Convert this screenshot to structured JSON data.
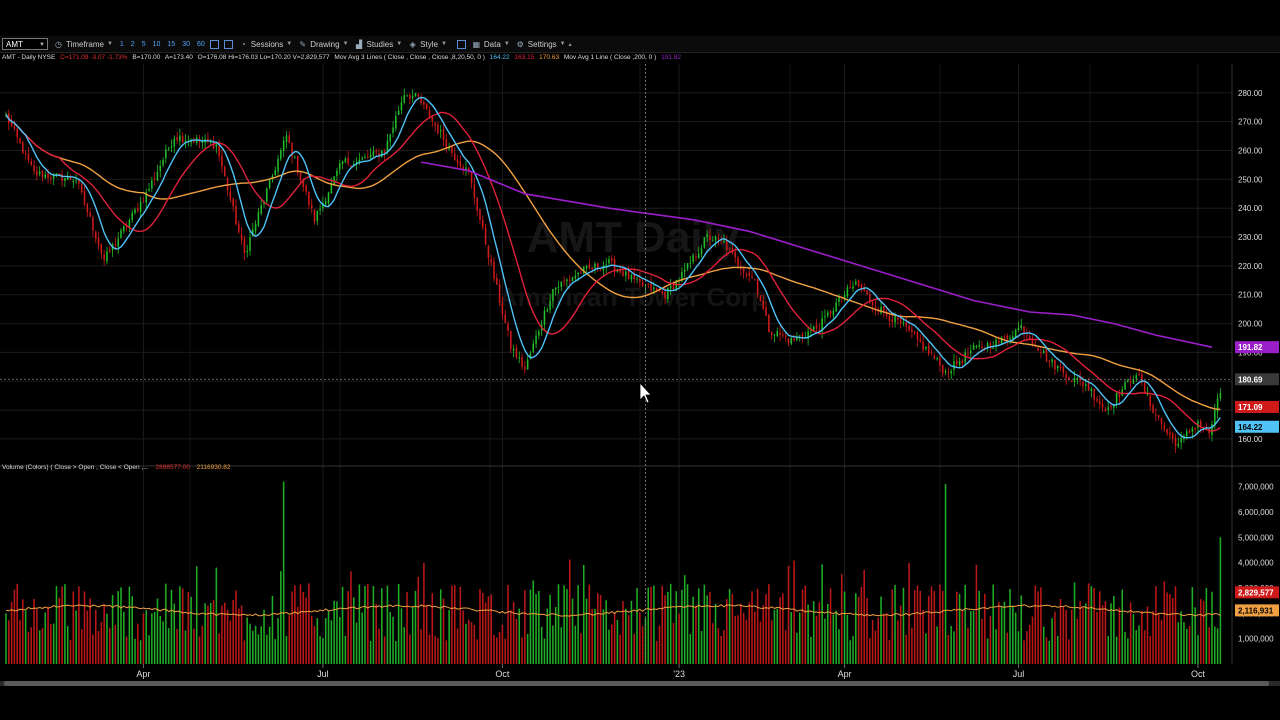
{
  "toolbar": {
    "symbol": "AMT",
    "timeframe_label": "Timeframe",
    "timeframe_buttons": [
      "1",
      "2",
      "5",
      "10",
      "15",
      "30",
      "60"
    ],
    "sessions_label": "Sessions",
    "drawing_label": "Drawing",
    "studies_label": "Studies",
    "style_label": "Style",
    "data_label": "Data",
    "settings_label": "Settings"
  },
  "info": {
    "symbol_line": "AMT - Daily  NYSE",
    "change": "C=171.09  -3.07  -1.73%",
    "bid": "B=170.00",
    "ask": "A=173.40",
    "ohlc": "O=176.08  Hi=176.03  Lo=170.20  V=2,829,577",
    "ma3_label": "Mov Avg 3 Lines ( Close , Close , Close ,8,20,50, 0 )",
    "ma3_v1": "164.22",
    "ma3_v2": "163.15",
    "ma3_v3": "170.63",
    "ma1_label": "Mov Avg 1 Line ( Close ,200, 0 )",
    "ma1_v": "191.82"
  },
  "watermark": {
    "title": "AMT Daily",
    "subtitle": "American Tower Corp"
  },
  "volume": {
    "header": "Volume (Colors) ( Close > Open , Close < Open ,...",
    "v1": "2898577.00",
    "v2": "2116930.82"
  },
  "price_badges": {
    "crosshair": "180.69",
    "ma200": "191.82",
    "last": "171.09",
    "ma8": "164.22"
  },
  "volume_badges": {
    "last": "2,829,577",
    "avg": "2,116,931"
  },
  "colors": {
    "up": "#22c02a",
    "down": "#d01a1a",
    "ma_fast": "#4fc3f7",
    "ma_mid": "#e0213a",
    "ma_slow": "#f0a040",
    "ma_200": "#9a1fc9"
  },
  "chart_data": {
    "type": "candlestick",
    "symbol": "AMT",
    "interval": "Daily",
    "price_axis": {
      "range": [
        152,
        290
      ],
      "ticks": [
        160,
        170,
        180,
        190,
        200,
        210,
        220,
        230,
        240,
        250,
        260,
        270,
        280
      ]
    },
    "volume_axis": {
      "range": [
        0,
        7500000
      ],
      "ticks": [
        1000000,
        2000000,
        3000000,
        4000000,
        5000000,
        6000000,
        7000000
      ],
      "tick_labels": [
        "1,000,000",
        "2,000,000",
        "3,000,000",
        "4,000,000",
        "5,000,000",
        "6,000,000",
        "7,000,000"
      ]
    },
    "x_labels": [
      {
        "label": "Apr",
        "day": 49
      },
      {
        "label": "Jul",
        "day": 113
      },
      {
        "label": "Oct",
        "day": 177
      },
      {
        "label": "'23",
        "day": 240
      },
      {
        "label": "Apr",
        "day": 299
      },
      {
        "label": "Jul",
        "day": 361
      },
      {
        "label": "Oct",
        "day": 425
      }
    ],
    "close_path": [
      [
        0,
        272
      ],
      [
        10,
        252
      ],
      [
        25,
        250
      ],
      [
        35,
        222
      ],
      [
        50,
        245
      ],
      [
        60,
        265
      ],
      [
        75,
        262
      ],
      [
        85,
        224
      ],
      [
        100,
        265
      ],
      [
        110,
        236
      ],
      [
        120,
        256
      ],
      [
        125,
        256
      ],
      [
        135,
        260
      ],
      [
        142,
        280
      ],
      [
        147,
        278
      ],
      [
        160,
        258
      ],
      [
        165,
        252
      ],
      [
        175,
        212
      ],
      [
        180,
        192
      ],
      [
        185,
        184
      ],
      [
        195,
        212
      ],
      [
        205,
        218
      ],
      [
        215,
        221
      ],
      [
        225,
        214
      ],
      [
        235,
        210
      ],
      [
        242,
        218
      ],
      [
        250,
        230
      ],
      [
        256,
        228
      ],
      [
        260,
        222
      ],
      [
        267,
        215
      ],
      [
        272,
        198
      ],
      [
        280,
        194
      ],
      [
        290,
        199
      ],
      [
        297,
        208
      ],
      [
        303,
        214
      ],
      [
        310,
        206
      ],
      [
        320,
        199
      ],
      [
        330,
        189
      ],
      [
        335,
        183
      ],
      [
        345,
        191
      ],
      [
        355,
        194
      ],
      [
        362,
        199
      ],
      [
        372,
        187
      ],
      [
        380,
        181
      ],
      [
        385,
        179
      ],
      [
        392,
        170
      ],
      [
        403,
        183
      ],
      [
        408,
        172
      ],
      [
        414,
        162
      ],
      [
        418,
        158
      ],
      [
        425,
        166
      ],
      [
        429,
        162
      ],
      [
        433,
        176
      ]
    ],
    "ma200_path": [
      [
        148,
        256
      ],
      [
        165,
        253
      ],
      [
        185,
        245
      ],
      [
        215,
        240
      ],
      [
        245,
        236
      ],
      [
        265,
        232
      ],
      [
        285,
        226
      ],
      [
        315,
        217
      ],
      [
        345,
        208
      ],
      [
        365,
        204
      ],
      [
        380,
        203
      ],
      [
        395,
        200
      ],
      [
        410,
        196
      ],
      [
        430,
        191.82
      ]
    ],
    "volume_avg": 2116931,
    "volume_spikes": [
      {
        "day": 99,
        "volume": 7200000
      },
      {
        "day": 335,
        "volume": 7100000
      },
      {
        "day": 433,
        "volume": 5000000
      }
    ],
    "crosshair": {
      "price": 180.69,
      "day": 228
    }
  }
}
